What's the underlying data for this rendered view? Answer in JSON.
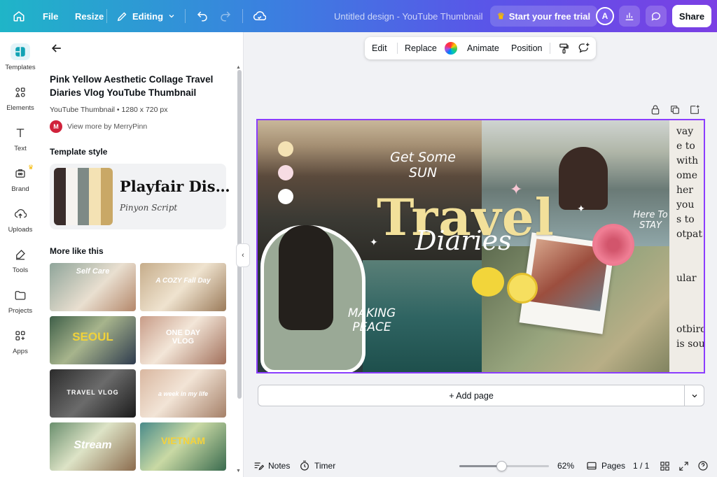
{
  "topbar": {
    "file_label": "File",
    "resize_label": "Resize",
    "mode_label": "Editing",
    "design_title": "Untitled design - YouTube Thumbnail",
    "trial_label": "Start your free trial",
    "avatar_initial": "A",
    "share_label": "Share"
  },
  "rail": {
    "items": [
      {
        "label": "Templates",
        "icon": "templates-icon"
      },
      {
        "label": "Elements",
        "icon": "elements-icon"
      },
      {
        "label": "Text",
        "icon": "text-icon"
      },
      {
        "label": "Brand",
        "icon": "brand-icon"
      },
      {
        "label": "Uploads",
        "icon": "uploads-icon"
      },
      {
        "label": "Tools",
        "icon": "tools-icon"
      },
      {
        "label": "Projects",
        "icon": "projects-icon"
      },
      {
        "label": "Apps",
        "icon": "apps-icon"
      }
    ]
  },
  "panel": {
    "title": "Pink Yellow Aesthetic Collage Travel Diaries Vlog YouTube Thumbnail",
    "subtitle": "YouTube Thumbnail • 1280 x 720 px",
    "author_initial": "M",
    "author_link": "View more by MerryPinn",
    "style_heading": "Template style",
    "font_primary": "Playfair Dis…",
    "font_secondary": "Pinyon Script",
    "swatch_colors": [
      "#3a2d2b",
      "#f6f3ef",
      "#7e8a86",
      "#f4e2b4",
      "#c9a866"
    ],
    "more_heading": "More like this",
    "thumbnails": [
      {
        "text": "Self Care"
      },
      {
        "text": "A COZY Fall Day"
      },
      {
        "text": "SEOUL"
      },
      {
        "text": "ONE DAY VLOG"
      },
      {
        "text": "TRAVEL VLOG"
      },
      {
        "text": "a week in my life"
      },
      {
        "text": "Stream"
      },
      {
        "text": "VIETNAM"
      }
    ]
  },
  "context_toolbar": {
    "edit_label": "Edit",
    "replace_label": "Replace",
    "animate_label": "Animate",
    "position_label": "Position"
  },
  "canvas": {
    "title_main": "Travel",
    "title_script": "Diaries",
    "tag_sun": "Get Some SUN",
    "tag_memories": "MAKING PEACE",
    "tag_stay": "Here To STAY",
    "newspaper_words": [
      "vay",
      "e to",
      "with",
      "ome",
      "her",
      "you",
      "s to",
      "otpat",
      "ular",
      "otbird",
      "is sou"
    ]
  },
  "add_page_label": "+ Add page",
  "bottombar": {
    "notes_label": "Notes",
    "timer_label": "Timer",
    "zoom_fraction": 0.47,
    "zoom_label": "62%",
    "pages_label": "Pages",
    "page_count": "1 / 1"
  }
}
